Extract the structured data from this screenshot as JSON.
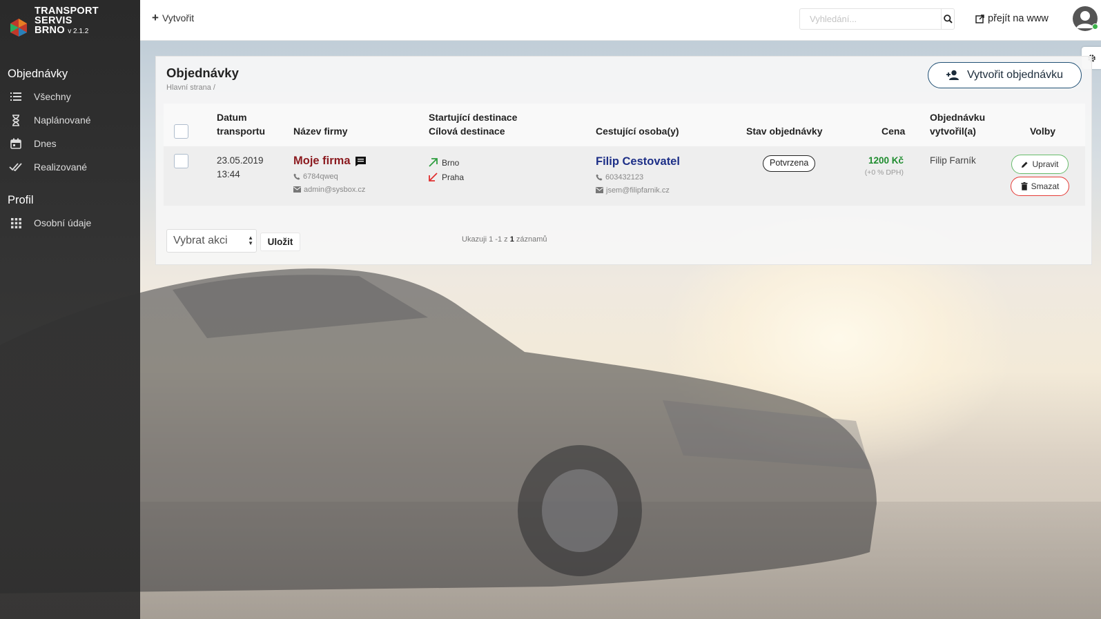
{
  "brand": {
    "line1": "TRANSPORT",
    "line2": "SERVIS",
    "line3": "BRNO",
    "version": "v 2.1.2"
  },
  "sidebar": {
    "sections": [
      {
        "title": "Objednávky",
        "items": [
          {
            "label": "Všechny",
            "icon": "list-icon"
          },
          {
            "label": "Naplánované",
            "icon": "hourglass-icon"
          },
          {
            "label": "Dnes",
            "icon": "calendar-icon"
          },
          {
            "label": "Realizované",
            "icon": "double-check-icon"
          }
        ]
      },
      {
        "title": "Profil",
        "items": [
          {
            "label": "Osobní údaje",
            "icon": "grid-icon"
          }
        ]
      }
    ]
  },
  "topbar": {
    "create_label": "Vytvořit",
    "search_placeholder": "Vyhledání...",
    "www_label": "přejít na www"
  },
  "page": {
    "title": "Objednávky",
    "breadcrumb": "Hlavní strana /",
    "create_order_label": "Vytvořit objednávku"
  },
  "table": {
    "headers": {
      "date_line1": "Datum",
      "date_line2": "transportu",
      "company": "Název firmy",
      "dest_line1": "Startující destinace",
      "dest_line2": "Cílová destinace",
      "person": "Cestující osoba(y)",
      "status": "Stav objednávky",
      "price": "Cena",
      "creator_line1": "Objednávku",
      "creator_line2": "vytvořil(a)",
      "options": "Volby"
    },
    "rows": [
      {
        "date": "23.05.2019",
        "time": "13:44",
        "company": "Moje firma",
        "company_phone": "6784qweq",
        "company_email": "admin@sysbox.cz",
        "start": "Brno",
        "end": "Praha",
        "person": "Filip Cestovatel",
        "person_phone": "603432123",
        "person_email": "jsem@filipfarnik.cz",
        "status": "Potvrzena",
        "price": "1200 Kč",
        "vat": "(+0 % DPH)",
        "creator": "Filip Farník",
        "edit_label": "Upravit",
        "delete_label": "Smazat"
      }
    ]
  },
  "footer": {
    "action_select_value": "Vybrat akci",
    "save_label": "Uložit",
    "records_prefix": "Ukazuji 1 -1 z",
    "records_total": "1",
    "records_suffix": "záznamů"
  },
  "colors": {
    "sidebar_bg": "#2a2a2a",
    "company_link": "#8b1a1f",
    "person_link": "#1d2f87",
    "price": "#1e8c2e",
    "edit_border": "#66bb6a",
    "delete_border": "#e53935",
    "create_order_border": "#1f4f74"
  }
}
